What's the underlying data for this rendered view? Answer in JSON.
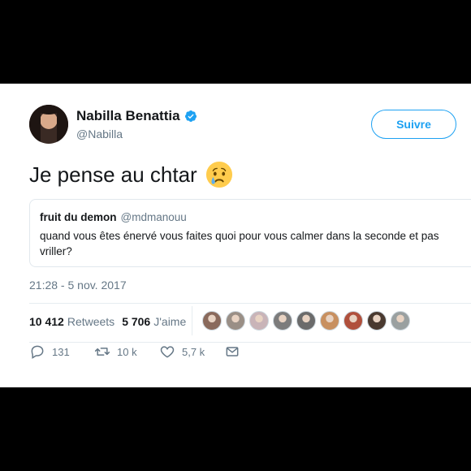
{
  "tweet": {
    "author_name": "Nabilla Benattia",
    "author_handle": "@Nabilla",
    "follow_label": "Suivre",
    "text": "Je pense au chtar",
    "emoji": "crying-face",
    "timestamp": "21:28 - 5 nov. 2017"
  },
  "quoted": {
    "name": "fruit du demon",
    "handle": "@mdmanouu",
    "text": "quand vous êtes énervé vous faites quoi pour vous calmer dans la seconde et pas vriller?"
  },
  "stats": {
    "retweets_count": "10 412",
    "retweets_label": "Retweets",
    "likes_count": "5 706",
    "likes_label": "J'aime"
  },
  "likers_colors": [
    "#8a6a5c",
    "#9a8f86",
    "#c9b4b8",
    "#7c7c7c",
    "#6b6b6b",
    "#c89060",
    "#b0503c",
    "#4a3a30",
    "#9aa0a0"
  ],
  "actions": {
    "reply_count": "131",
    "retweet_count": "10 k",
    "like_count": "5,7 k"
  },
  "colors": {
    "accent": "#1da1f2",
    "secondary_text": "#657786"
  }
}
